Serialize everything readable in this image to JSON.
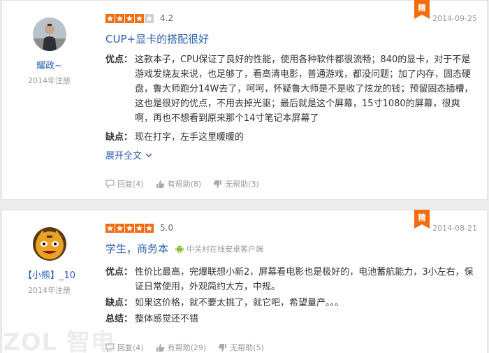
{
  "reviews": [
    {
      "username": "耀政~",
      "regdate": "2014年注册",
      "rating_value": 4,
      "score": "4.2",
      "badge": "精",
      "date": "2014-09-25",
      "title": "CUP+显卡的搭配很好",
      "pros_label": "优点：",
      "pros_text": "这款本子，CPU保证了良好的性能，使用各种软件都很流畅；840的显卡，对于不是游戏发烧友来说，也足够了，看高清电影，普通游戏，都没问题；加了内存，固态硬盘，鲁大师跑分14W去了，呵呵，怀疑鲁大师是不是收了炫龙的钱；预留固态插槽，这也是很好的优点，不用去掉光驱；最后就是这个屏幕，15寸1080的屏幕，很爽啊，再也不想看到原来那个14寸笔记本屏幕了",
      "cons_label": "缺点：",
      "cons_text": "现在打字，左手这里暖暖的",
      "expand_label": "展开全文",
      "reply_label": "回复(4)",
      "helpful_label": "有帮助(8)",
      "unhelpful_label": "无帮助(3)"
    },
    {
      "username": "【小熊】_10",
      "regdate": "2014年注册",
      "rating_value": 5,
      "score": "5.0",
      "badge": "精",
      "date": "2014-08-21",
      "title": "学生，商务本",
      "client": "中关村在线安卓客户端",
      "pros_label": "优点：",
      "pros_text": "性价比最高，完爆联想小新2，屏幕看电影也是极好的，电池蓄航能力，3小左右，保证日常使用，外观简约大方，中规。",
      "cons_label": "缺点：",
      "cons_text": "如果这价格，就不要太挑了，就它吧，希望量产。。。",
      "summary_label": "总结：",
      "summary_text": "整体感觉还不错",
      "reply_label": "回复(4)",
      "helpful_label": "有帮助(29)",
      "unhelpful_label": "无帮助(5)"
    }
  ],
  "watermark": "ZOL 智电",
  "colors": {
    "link": "#2a5fb0",
    "star": "#f26c10",
    "badge": "#f26c10"
  }
}
